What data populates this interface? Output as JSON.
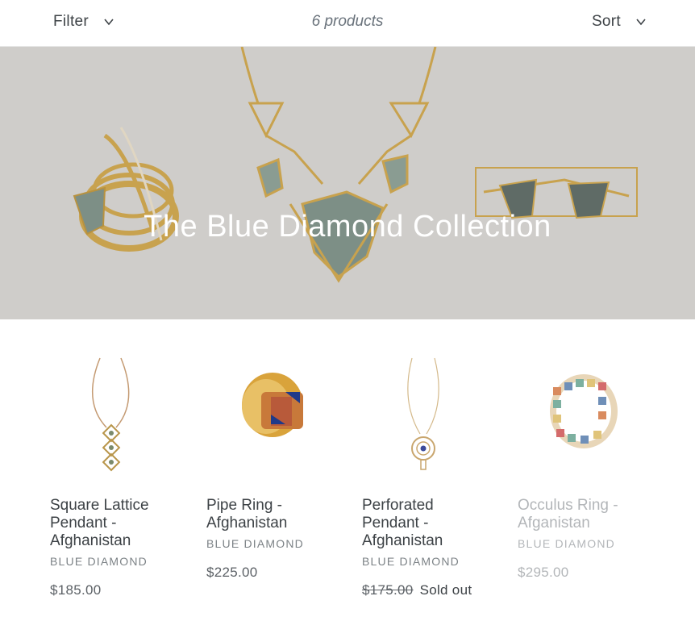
{
  "toolbar": {
    "filter_label": "Filter",
    "product_count": "6 products",
    "sort_label": "Sort"
  },
  "hero": {
    "title": "The Blue Diamond Collection"
  },
  "products": [
    {
      "title": "Square Lattice Pendant - Afghanistan",
      "vendor": "BLUE DIAMOND",
      "price": "$185.00"
    },
    {
      "title": "Pipe Ring - Afghanistan",
      "vendor": "BLUE DIAMOND",
      "price": "$225.00"
    },
    {
      "title": "Perforated Pendant - Afghanistan",
      "vendor": "BLUE DIAMOND",
      "price": "$175.00",
      "status": "Sold out"
    },
    {
      "title": "Occulus Ring - Afganistan",
      "vendor": "BLUE DIAMOND",
      "price": "$295.00"
    }
  ],
  "icons": {
    "filter_chevron": "chevron-down-icon",
    "sort_chevron": "chevron-down-icon"
  },
  "colors": {
    "hero_background": "#cfcdca",
    "gold": "#c8a24e",
    "stone": "#7d8f86"
  }
}
